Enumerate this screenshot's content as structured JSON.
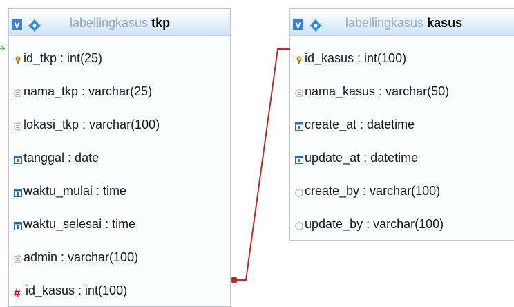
{
  "tables": {
    "tkp": {
      "db": "labellingkasus",
      "name": "tkp",
      "columns": [
        {
          "label": "id_tkp : int(25)",
          "kind": "primary-key"
        },
        {
          "label": "nama_tkp : varchar(25)",
          "kind": "text"
        },
        {
          "label": "lokasi_tkp : varchar(100)",
          "kind": "text"
        },
        {
          "label": "tanggal : date",
          "kind": "date"
        },
        {
          "label": "waktu_mulai : time",
          "kind": "date"
        },
        {
          "label": "waktu_selesai : time",
          "kind": "date"
        },
        {
          "label": "admin : varchar(100)",
          "kind": "text"
        },
        {
          "label": "id_kasus : int(100)",
          "kind": "foreign-key"
        }
      ]
    },
    "kasus": {
      "db": "labellingkasus",
      "name": "kasus",
      "columns": [
        {
          "label": "id_kasus : int(100)",
          "kind": "primary-key"
        },
        {
          "label": "nama_kasus : varchar(50)",
          "kind": "text"
        },
        {
          "label": "create_at : datetime",
          "kind": "date"
        },
        {
          "label": "update_at : datetime",
          "kind": "date"
        },
        {
          "label": "create_by : varchar(100)",
          "kind": "text"
        },
        {
          "label": "update_by : varchar(100)",
          "kind": "text"
        }
      ]
    }
  },
  "header_button": "v",
  "colors": {
    "relation_line": "#b0302a",
    "header_accent": "#3f7fd0",
    "db_name": "#8fa7c8"
  }
}
